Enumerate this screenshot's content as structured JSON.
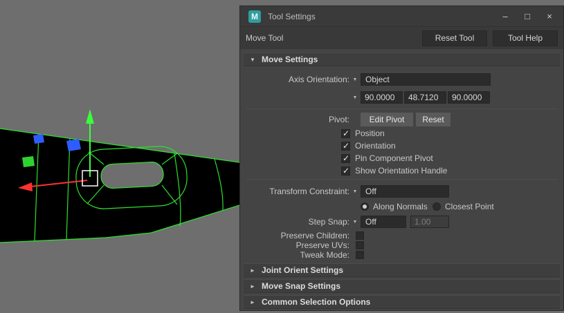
{
  "colors": {
    "viewport_bg": "#6e6e6e",
    "wireframe_green": "#2ee02e",
    "axis_x_red": "#ff3131",
    "axis_y_green": "#3bff3b",
    "axis_z_blue": "#2f5cff",
    "logo_teal": "#2f9e9e",
    "panel_bg": "#444444",
    "field_bg": "#2b2b2b"
  },
  "icons": {
    "logo": "M",
    "minimize": "–",
    "maximize": "□",
    "close": "×",
    "dropdown": "▼",
    "collapse_open": "▼",
    "collapse_closed": "►",
    "check": "✓"
  },
  "titlebar": {
    "title": "Tool Settings"
  },
  "toolbar": {
    "tool_name": "Move Tool",
    "reset_tool": "Reset Tool",
    "tool_help": "Tool Help"
  },
  "move_settings": {
    "label": "Move Settings",
    "axis_orientation": {
      "label": "Axis Orientation:",
      "value": "Object"
    },
    "orientation_values": [
      "90.0000",
      "48.7120",
      "90.0000"
    ],
    "pivot": {
      "label": "Pivot:",
      "edit_button": "Edit Pivot",
      "reset_button": "Reset"
    },
    "pivot_options": [
      {
        "label": "Position",
        "checked": "true"
      },
      {
        "label": "Orientation",
        "checked": "true"
      },
      {
        "label": "Pin Component Pivot",
        "checked": "true"
      },
      {
        "label": "Show Orientation Handle",
        "checked": "true"
      }
    ],
    "transform_constraint": {
      "label": "Transform Constraint:",
      "value": "Off"
    },
    "constraint_modes": [
      {
        "label": "Along Normals",
        "selected": "true"
      },
      {
        "label": "Closest Point",
        "selected": "false"
      }
    ],
    "step_snap": {
      "label": "Step Snap:",
      "value": "Off",
      "increment": "1.00"
    },
    "toggles": [
      {
        "label": "Preserve Children:",
        "checked": "false"
      },
      {
        "label": "Preserve UVs:",
        "checked": "false"
      },
      {
        "label": "Tweak Mode:",
        "checked": "false"
      }
    ]
  },
  "sections": {
    "joint_orient": "Joint Orient Settings",
    "move_snap": "Move Snap Settings",
    "common_selection": "Common Selection Options"
  }
}
